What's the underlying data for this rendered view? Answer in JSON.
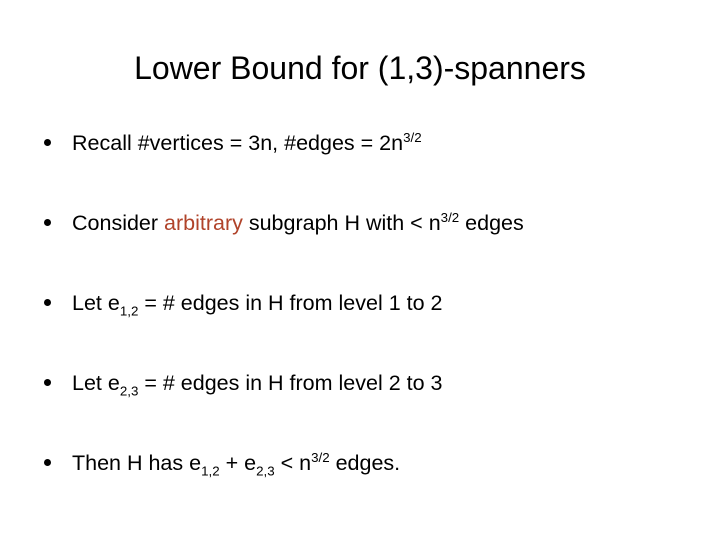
{
  "slide": {
    "title": "Lower Bound for (1,3)-spanners",
    "background_color": "#ffffff",
    "text_color": "#000000",
    "highlight_color": "#b0432a",
    "bullet_glyph": "•",
    "bullets": [
      {
        "id": "bullet-recall-counts",
        "plain_text": "Recall #vertices = 3n, #edges = 2n3/2",
        "parts": [
          {
            "text": "Recall #vertices = 3n, #edges = 2n",
            "style": "normal"
          },
          {
            "text": "3/2",
            "style": "superscript"
          }
        ]
      },
      {
        "id": "bullet-consider-subgraph",
        "plain_text": "Consider arbitrary subgraph H with < n3/2 edges",
        "parts": [
          {
            "text": "Consider ",
            "style": "normal"
          },
          {
            "text": "arbitrary",
            "style": "highlight"
          },
          {
            "text": " subgraph H with < n",
            "style": "normal"
          },
          {
            "text": "3/2",
            "style": "superscript"
          },
          {
            "text": " edges",
            "style": "normal"
          }
        ]
      },
      {
        "id": "bullet-let-e12",
        "plain_text": "Let e1,2 = # edges in H from level 1 to 2",
        "parts": [
          {
            "text": "Let e",
            "style": "normal"
          },
          {
            "text": "1,2",
            "style": "subscript"
          },
          {
            "text": " = # edges in H from level 1 to 2",
            "style": "normal"
          }
        ]
      },
      {
        "id": "bullet-let-e23",
        "plain_text": "Let e2,3 = # edges in H from level 2 to 3",
        "parts": [
          {
            "text": "Let e",
            "style": "normal"
          },
          {
            "text": "2,3",
            "style": "subscript"
          },
          {
            "text": " = # edges in H from level 2 to 3",
            "style": "normal"
          }
        ]
      },
      {
        "id": "bullet-then-h-has",
        "plain_text": "Then H has e1,2 + e2,3 < n3/2 edges.",
        "parts": [
          {
            "text": "Then H has e",
            "style": "normal"
          },
          {
            "text": "1,2",
            "style": "subscript"
          },
          {
            "text": " + e",
            "style": "normal"
          },
          {
            "text": "2,3",
            "style": "subscript"
          },
          {
            "text": " < n",
            "style": "normal"
          },
          {
            "text": "3/2",
            "style": "superscript"
          },
          {
            "text": " edges.",
            "style": "normal"
          }
        ]
      }
    ]
  }
}
